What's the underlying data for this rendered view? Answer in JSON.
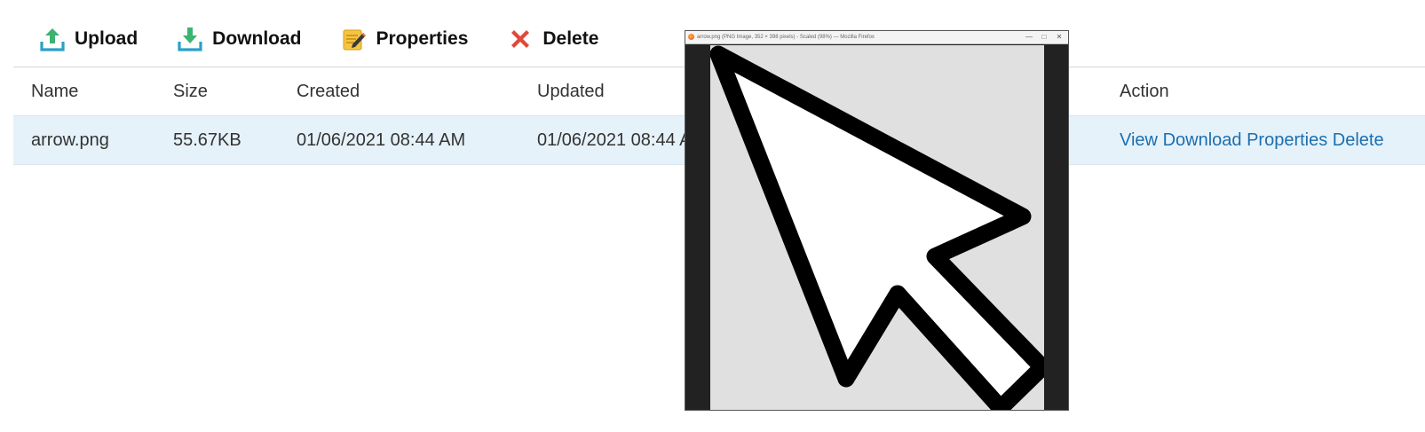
{
  "toolbar": {
    "upload_label": "Upload",
    "download_label": "Download",
    "properties_label": "Properties",
    "delete_label": "Delete"
  },
  "table": {
    "headers": [
      "Name",
      "Size",
      "Created",
      "Updated",
      "Action"
    ],
    "rows": [
      {
        "name": "arrow.png",
        "size": "55.67KB",
        "created": "01/06/2021 08:44 AM",
        "updated": "01/06/2021 08:44 AM",
        "actions": [
          "View",
          "Download",
          "Properties",
          "Delete"
        ]
      }
    ]
  },
  "viewer": {
    "title": "arrow.png (PNG Image, 352 × 398 pixels) - Scaled (98%) — Mozilla Firefox",
    "minimize_icon": "—",
    "maximize_icon": "□",
    "close_icon": "✕",
    "image_subject": "arrow-cursor"
  },
  "colors": {
    "row_selected": "#e6f2fa",
    "link": "#1a6fb0",
    "upload_icon": "#2aa0c9",
    "download_icon": "#2aa0c9",
    "arrow_green": "#3cb371",
    "delete_icon": "#e0483a",
    "properties_icon": "#f5c542"
  }
}
